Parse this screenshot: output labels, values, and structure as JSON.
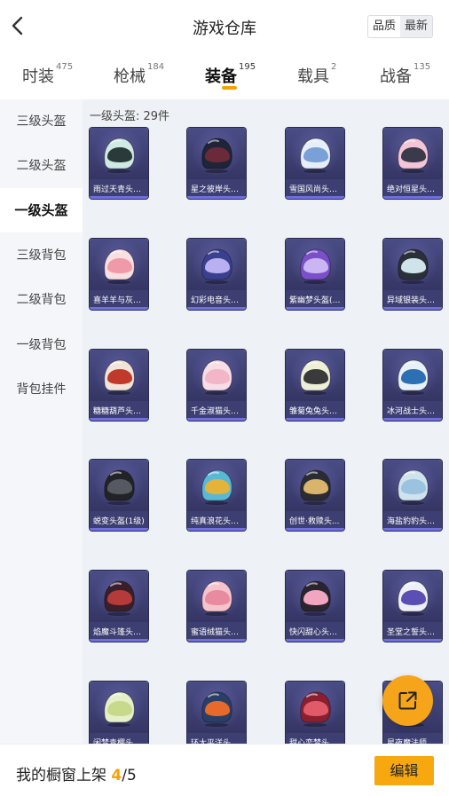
{
  "header": {
    "title": "游戏仓库",
    "sort": [
      "品质",
      "最新"
    ],
    "sort_selected": "最新"
  },
  "tabs": [
    {
      "label": "时装",
      "count": "475"
    },
    {
      "label": "枪械",
      "count": "184"
    },
    {
      "label": "装备",
      "count": "195"
    },
    {
      "label": "载具",
      "count": "2"
    },
    {
      "label": "战备",
      "count": "135"
    }
  ],
  "active_tab": "装备",
  "sidebar": [
    "三级头盔",
    "二级头盔",
    "一级头盔",
    "三级背包",
    "二级背包",
    "一级背包",
    "背包挂件"
  ],
  "active_sidebar": "一级头盔",
  "content": {
    "count_label": "一级头盔: 29件",
    "items": [
      {
        "name": "雨过天青头盔...",
        "color": "#cfe9e3",
        "visor": "#2a3a3a"
      },
      {
        "name": "星之彼岸头盔...",
        "color": "#1f2438",
        "visor": "#6b2a3a"
      },
      {
        "name": "雪国风尚头盔...",
        "color": "#e6eefa",
        "visor": "#7aa0d8"
      },
      {
        "name": "绝对恒星头盔...",
        "color": "#f2c6d6",
        "visor": "#3a3a4a"
      },
      {
        "name": "喜羊羊与灰太...",
        "color": "#f7dfe2",
        "visor": "#ef9aa6"
      },
      {
        "name": "幻彩电音头盔...",
        "color": "#3b3f8f",
        "visor": "#b8b0f0"
      },
      {
        "name": "紫幽梦头盔(1...",
        "color": "#7b4fc9",
        "visor": "#c9b6f2"
      },
      {
        "name": "异域银装头盔...",
        "color": "#2a2f3a",
        "visor": "#cfe4ea"
      },
      {
        "name": "糖糖葫芦头盔...",
        "color": "#f1e4d8",
        "visor": "#c0392b"
      },
      {
        "name": "千金淑猫头盔...",
        "color": "#f7dde6",
        "visor": "#f2b6c8"
      },
      {
        "name": "雏菊兔兔头盔...",
        "color": "#edf0d6",
        "visor": "#3a3a3a"
      },
      {
        "name": "冰河战士头盔...",
        "color": "#e9f1f8",
        "visor": "#2c6fb3"
      },
      {
        "name": "蜕变头盔(1级)",
        "color": "#222326",
        "visor": "#555a62"
      },
      {
        "name": "纯真浪花头盔...",
        "color": "#58b9d6",
        "visor": "#e3b33a"
      },
      {
        "name": "创世·救赎头...",
        "color": "#2b2b33",
        "visor": "#d9b46a"
      },
      {
        "name": "海盐豹豹头盔...",
        "color": "#cfe3ee",
        "visor": "#9bc2de"
      },
      {
        "name": "焰魔斗篷头盔...",
        "color": "#3a1f2a",
        "visor": "#b53a3a"
      },
      {
        "name": "蜜语绒猫头盔...",
        "color": "#f5c3cc",
        "visor": "#e88aa0"
      },
      {
        "name": "快闪甜心头盔...",
        "color": "#2a2430",
        "visor": "#f0a6c0"
      },
      {
        "name": "圣堂之誓头盔...",
        "color": "#eef0f7",
        "visor": "#5b4fb3"
      },
      {
        "name": "闲梦青樱头盔...",
        "color": "#e5efc8",
        "visor": "#c7d98a"
      },
      {
        "name": "环太平洋头盔...",
        "color": "#2a3f66",
        "visor": "#e76a2b"
      },
      {
        "name": "甜心恋梦头盔...",
        "color": "#8c1f2f",
        "visor": "#e05a6a"
      },
      {
        "name": "星夜魔法师头...",
        "color": "#4a3a8a",
        "visor": "#a99be0"
      }
    ]
  },
  "bottom": {
    "label": "我的橱窗上架",
    "current": "4",
    "separator": "/",
    "max": "5",
    "edit_label": "编辑"
  },
  "colors": {
    "accent": "#f5a300",
    "card_bg": "#3d3f72",
    "card_edge": "#6f6fe0"
  },
  "icons": {
    "back": "back-arrow-icon",
    "share": "share-external-icon"
  }
}
